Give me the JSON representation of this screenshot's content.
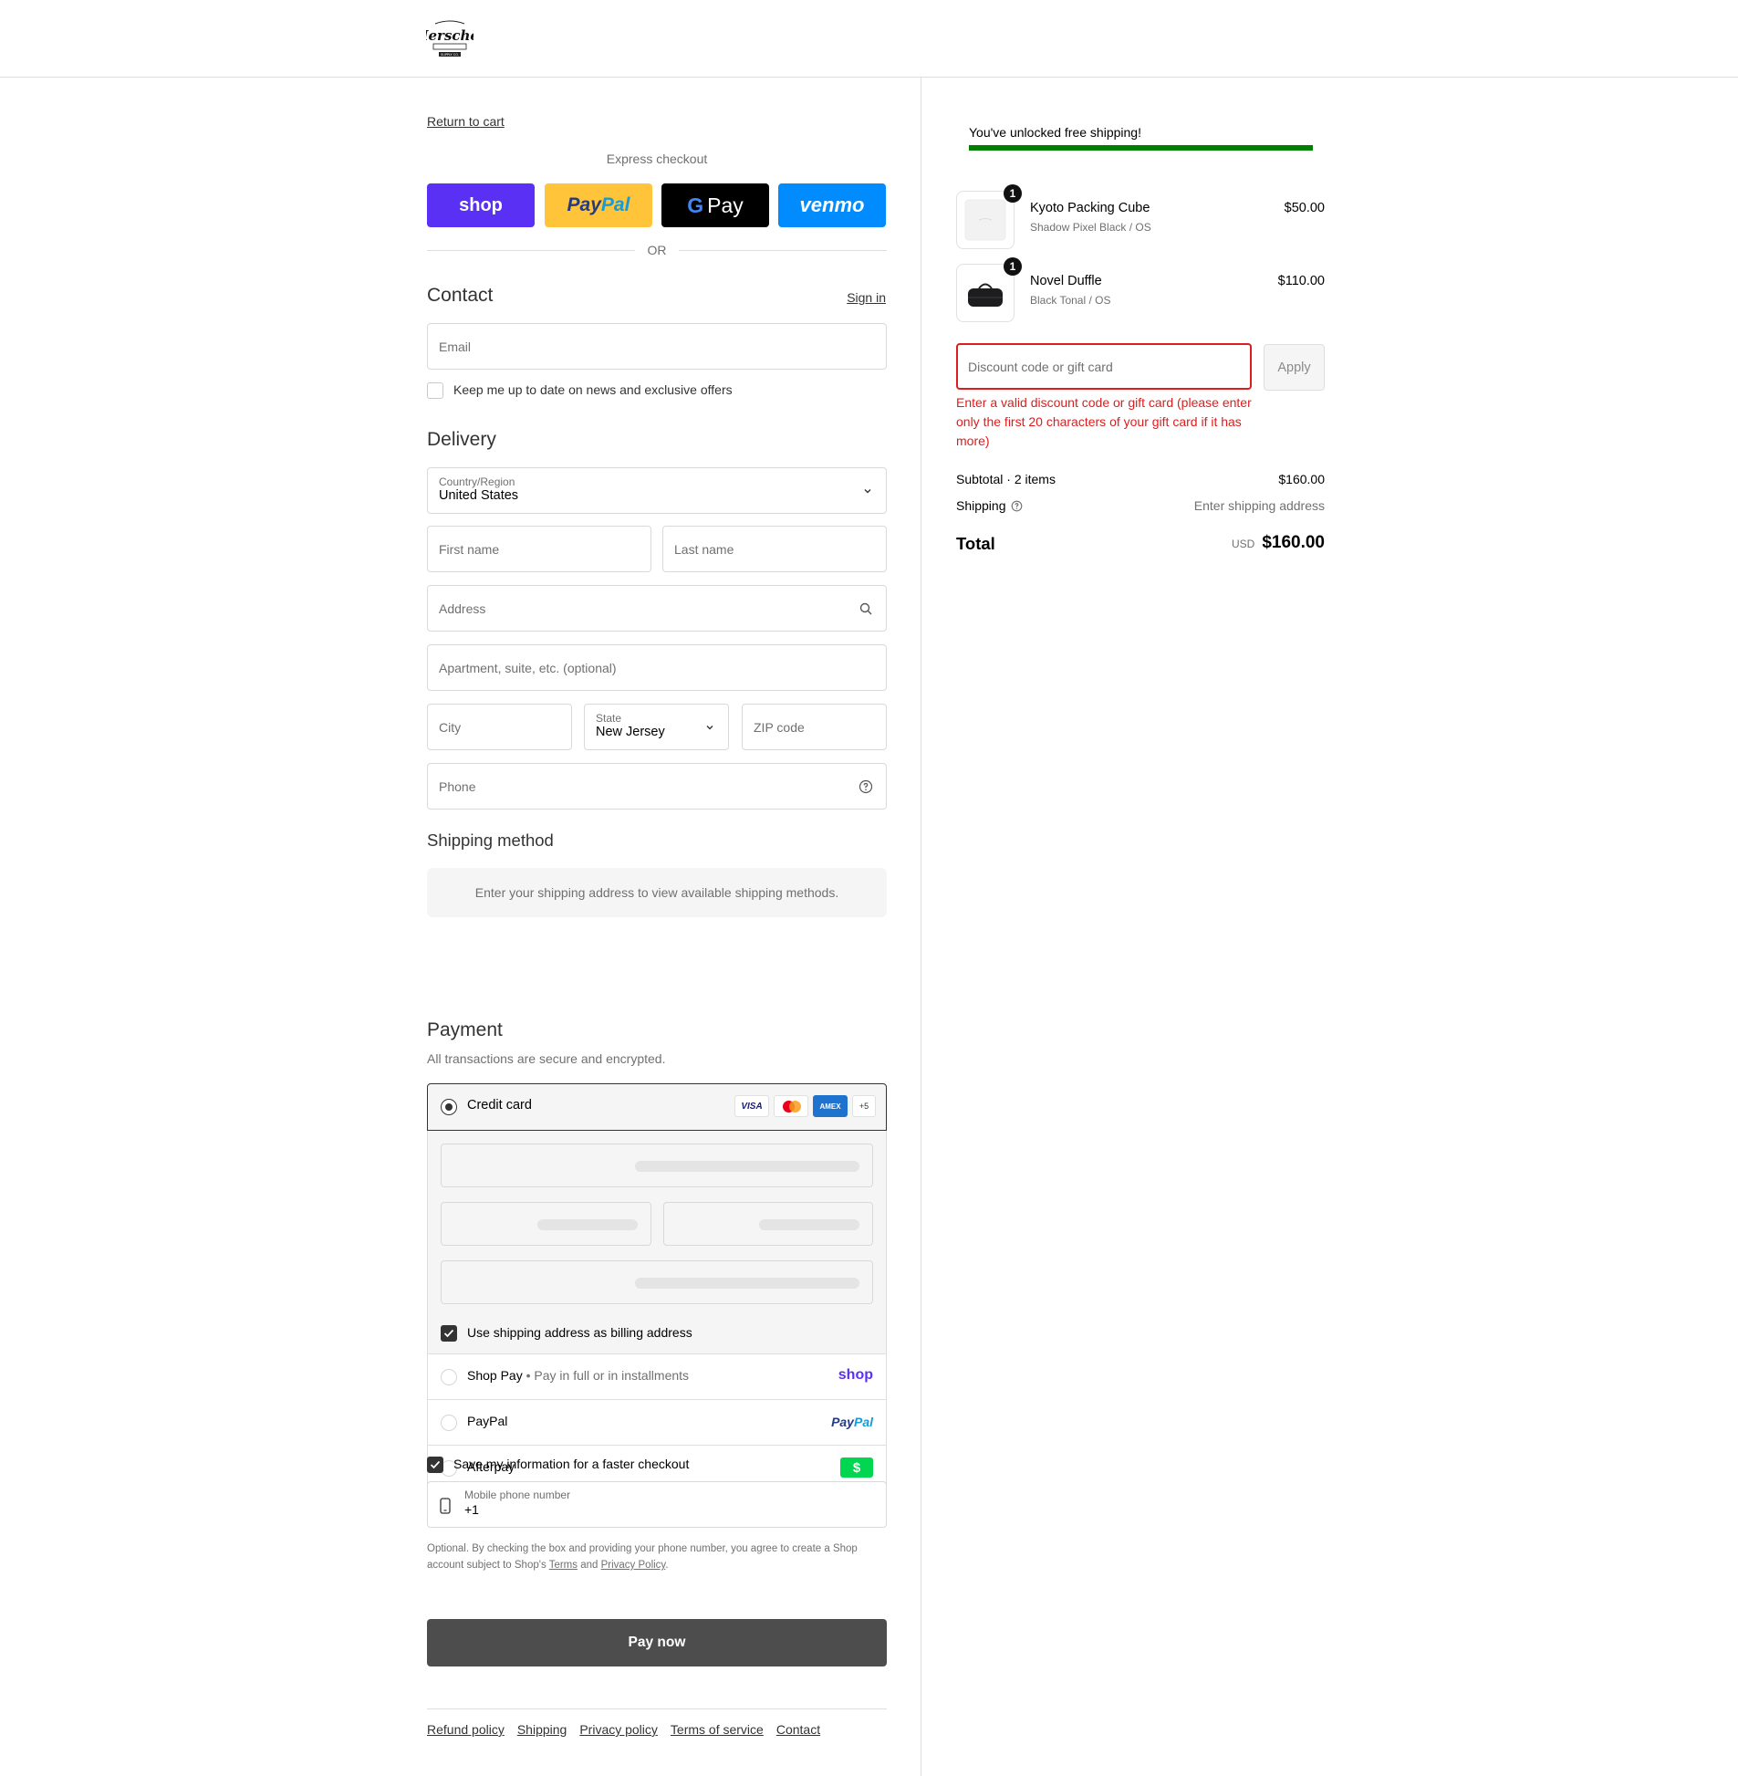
{
  "header": {
    "logo_text": "Herschel",
    "logo_sub": "SUPPLY CO."
  },
  "checkout": {
    "return_link": "Return to cart",
    "express_title": "Express checkout",
    "express_buttons": {
      "shop": "shop",
      "paypal_a": "Pay",
      "paypal_b": "Pal",
      "gpay_g": "G",
      "gpay": "Pay",
      "venmo": "venmo"
    },
    "or_label": "OR",
    "contact": {
      "title": "Contact",
      "sign_in": "Sign in",
      "email_placeholder": "Email",
      "newsletter_label": "Keep me up to date on news and exclusive offers"
    },
    "delivery": {
      "title": "Delivery",
      "country_label": "Country/Region",
      "country_value": "United States",
      "first_name": "First name",
      "last_name": "Last name",
      "address": "Address",
      "apartment": "Apartment, suite, etc. (optional)",
      "city": "City",
      "state_label": "State",
      "state_value": "New Jersey",
      "zip": "ZIP code",
      "phone": "Phone"
    },
    "shipping_method": {
      "title": "Shipping method",
      "notice": "Enter your shipping address to view available shipping methods."
    },
    "payment": {
      "title": "Payment",
      "subtitle": "All transactions are secure and encrypted.",
      "credit_card": "Credit card",
      "card_badges": {
        "visa": "VISA",
        "amex": "AMEX",
        "more": "+5"
      },
      "billing_same": "Use shipping address as billing address",
      "shop_pay": "Shop Pay",
      "shop_pay_sep": "•",
      "shop_pay_desc": "Pay in full or in installments",
      "shop_pay_logo": "shop",
      "paypal": "PayPal",
      "paypal_logo_a": "Pay",
      "paypal_logo_b": "Pal",
      "afterpay": "Afterpay",
      "afterpay_logo": "$"
    },
    "remember": {
      "label": "Save my information for a faster checkout",
      "mobile_label": "Mobile phone number",
      "mobile_value": "+1",
      "legal_1": "Optional. By checking the box and providing your phone number, you agree to create a Shop account subject to Shop's",
      "legal_terms": "Terms",
      "legal_and": "and",
      "legal_privacy": "Privacy Policy",
      "legal_end": "."
    },
    "pay_now": "Pay now",
    "footer_links": [
      "Refund policy",
      "Shipping",
      "Privacy policy",
      "Terms of service",
      "Contact"
    ]
  },
  "summary": {
    "free_shipping": "You've unlocked free shipping!",
    "free_shipping_progress": 1.0,
    "items": [
      {
        "qty": "1",
        "name": "Kyoto Packing Cube",
        "variant": "Shadow Pixel Black / OS",
        "price": "$50.00"
      },
      {
        "qty": "1",
        "name": "Novel Duffle",
        "variant": "Black Tonal / OS",
        "price": "$110.00"
      }
    ],
    "discount_placeholder": "Discount code or gift card",
    "apply": "Apply",
    "discount_error": "Enter a valid discount code or gift card (please enter only the first 20 characters of your gift card if it has more)",
    "subtotal_label": "Subtotal · 2 items",
    "subtotal_value": "$160.00",
    "shipping_label": "Shipping",
    "shipping_value": "Enter shipping address",
    "total_label": "Total",
    "currency": "USD",
    "total_value": "$160.00"
  },
  "colors": {
    "accent": "#333333",
    "error": "#dd1d1d",
    "shop_purple": "#5a31f4",
    "paypal_yellow": "#ffc439",
    "venmo_blue": "#008cff",
    "progress_green": "#008000",
    "afterpay_green": "#00d64f"
  }
}
